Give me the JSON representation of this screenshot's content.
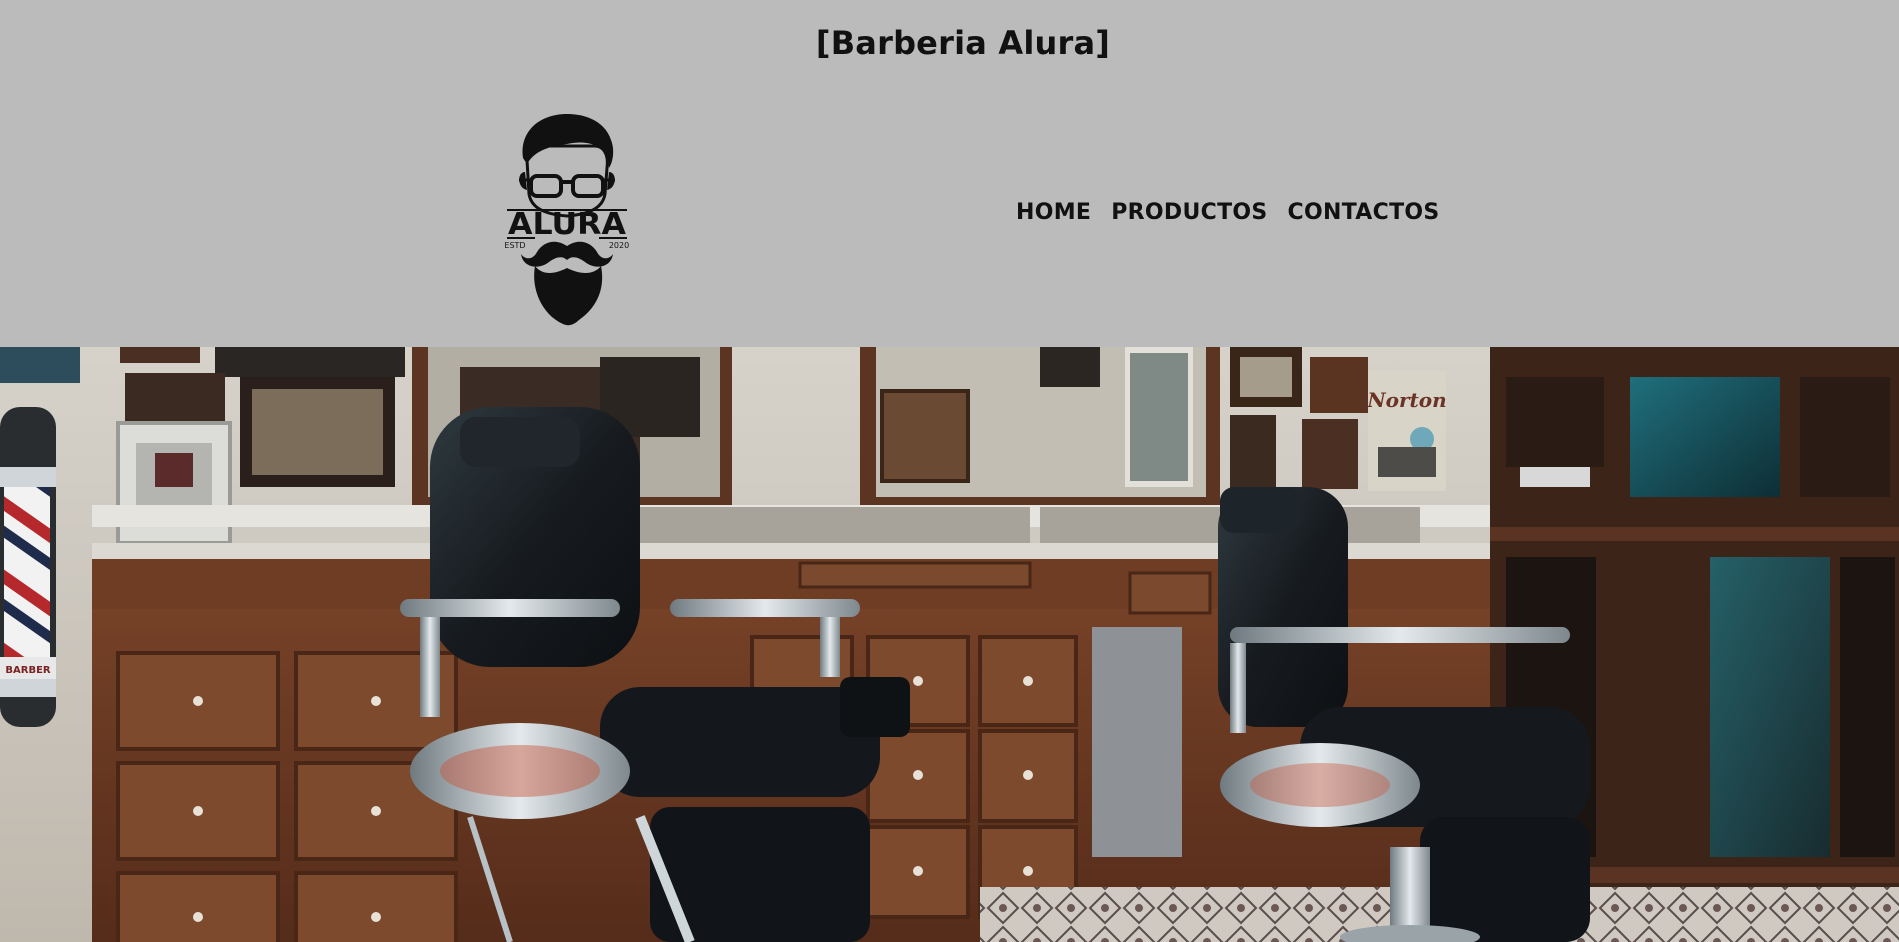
{
  "header": {
    "title": "[Barberia Alura]"
  },
  "logo": {
    "wordmark": "ALURA",
    "left_caption": "ESTD",
    "right_caption": "2020",
    "icon": "bearded-man-glasses-icon"
  },
  "nav": {
    "items": [
      {
        "label": "HOME"
      },
      {
        "label": "PRODUCTOS"
      },
      {
        "label": "CONTACTOS"
      }
    ]
  },
  "hero": {
    "poster_text": "Norton",
    "chair_badge": "BARBER"
  },
  "colors": {
    "header_bg": "#bbbbbb",
    "text": "#111111",
    "wood": "#6b3a24",
    "leather": "#1b1e22",
    "chrome": "#b9c4cb"
  }
}
